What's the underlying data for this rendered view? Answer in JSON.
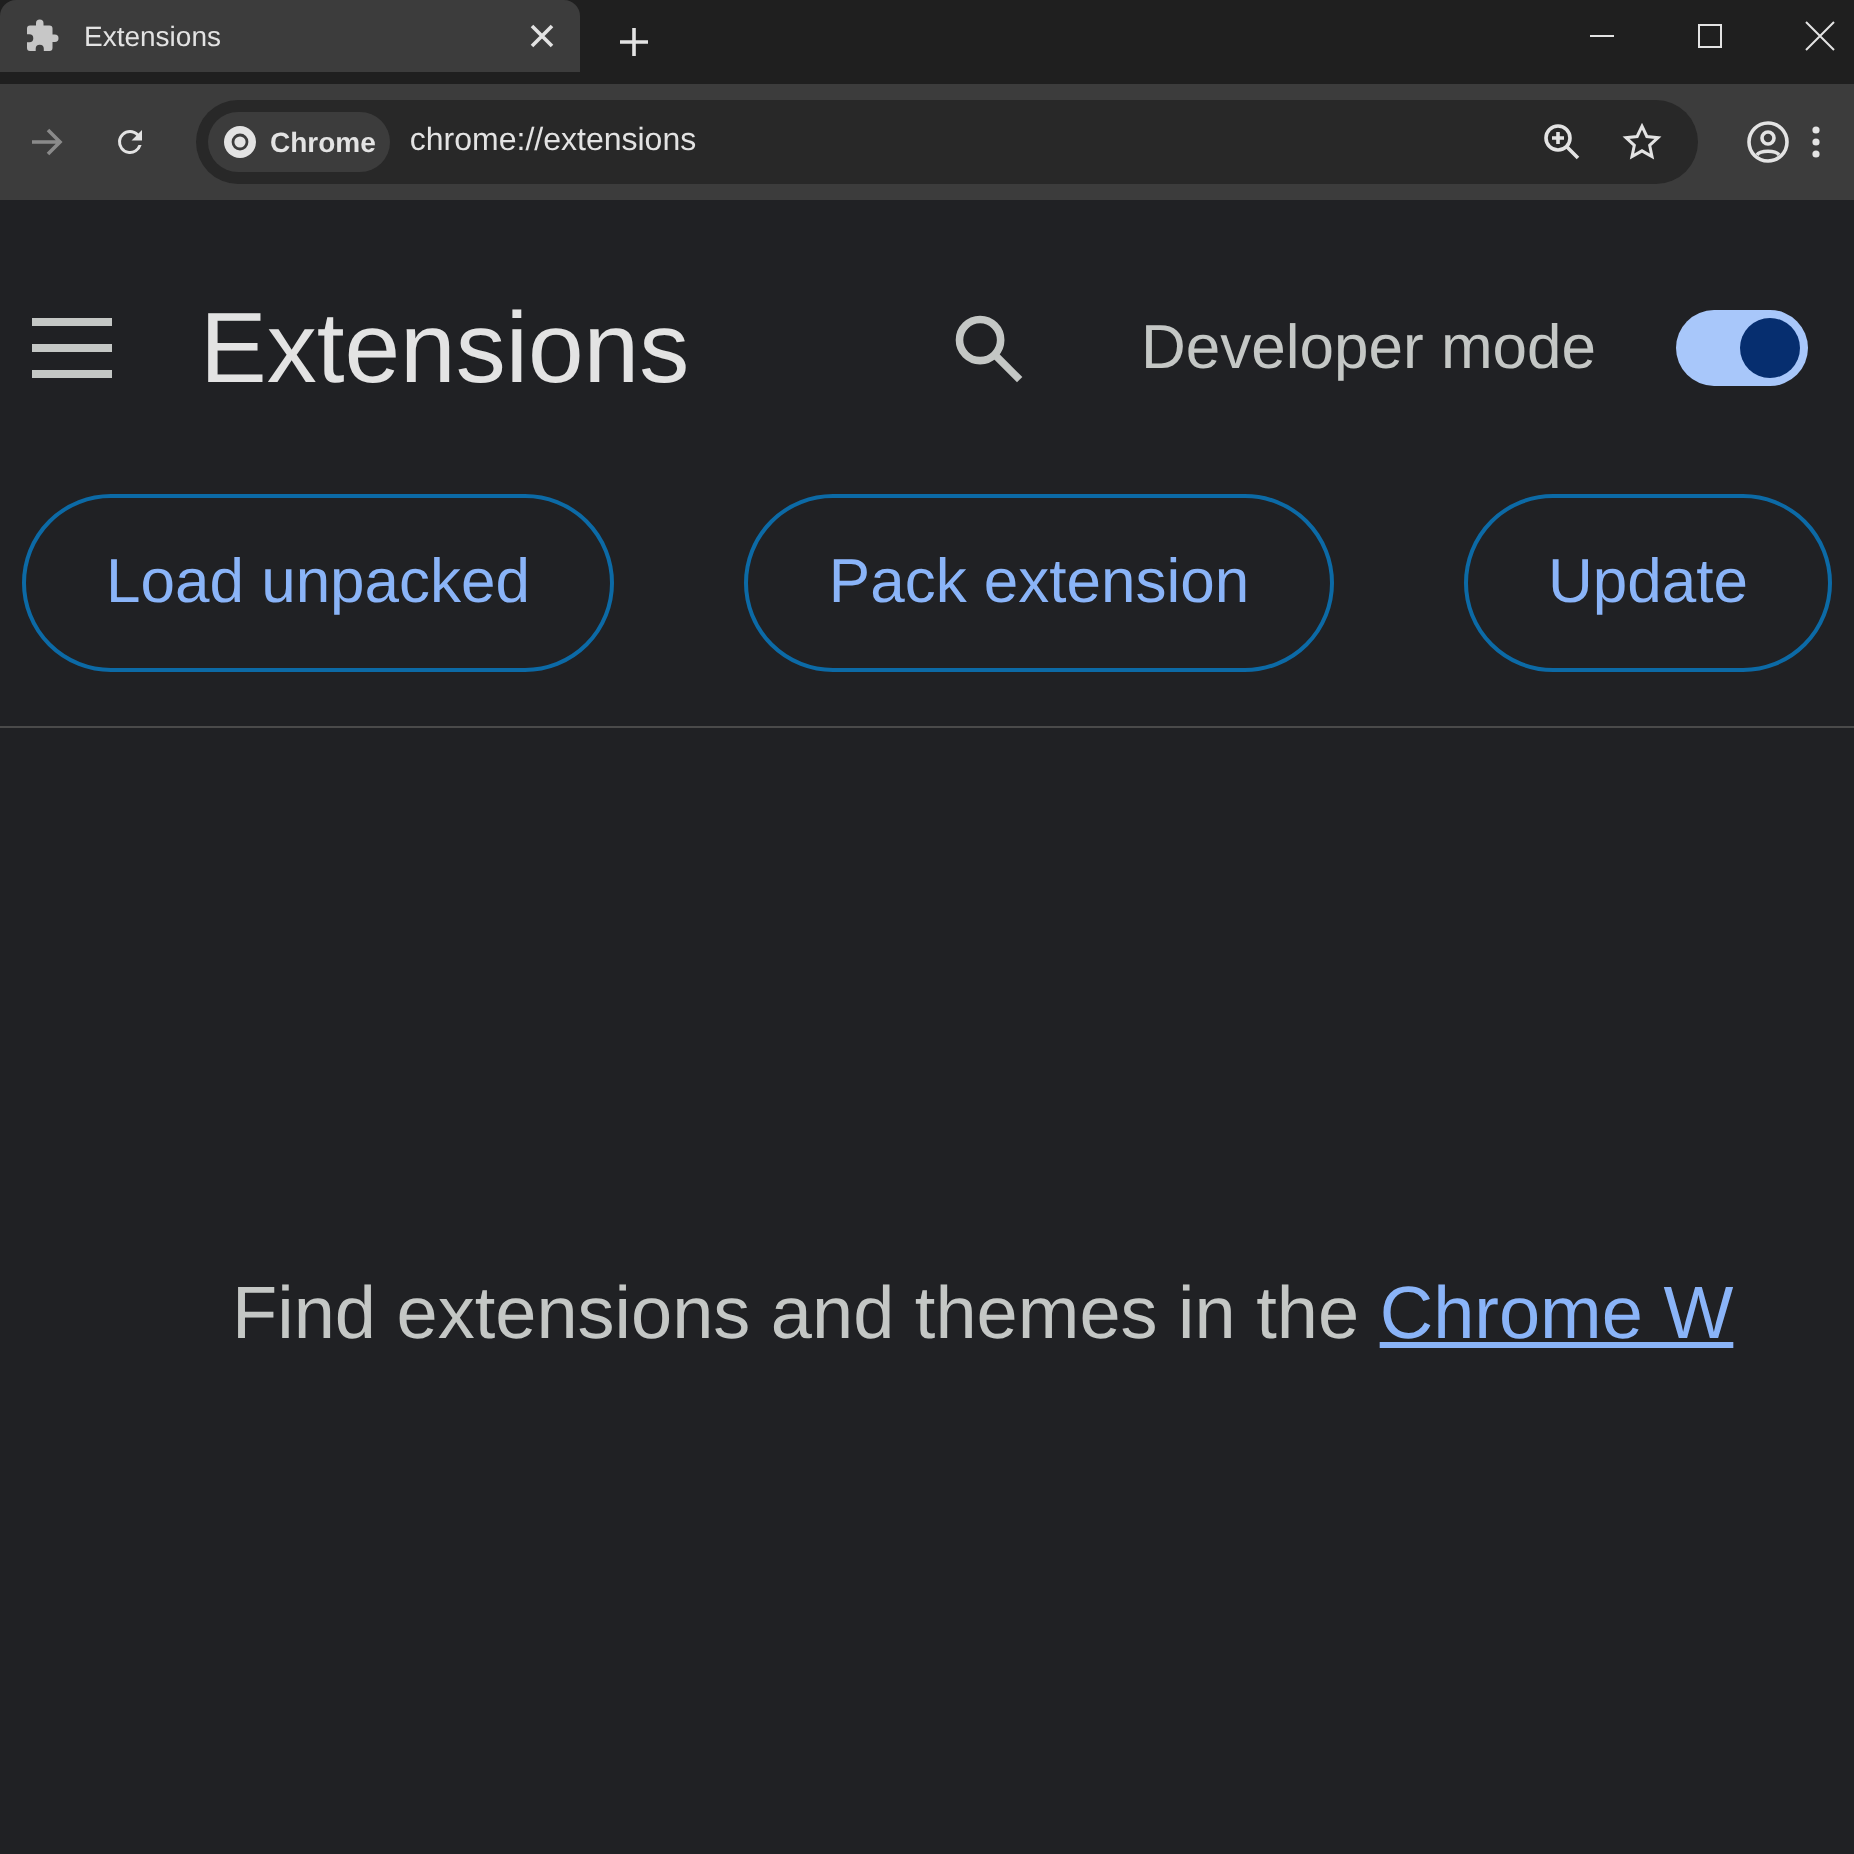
{
  "tab": {
    "title": "Extensions",
    "selected": true
  },
  "address_bar": {
    "chip": "Chrome",
    "url": "chrome://extensions"
  },
  "header": {
    "title": "Extensions",
    "developer_mode": {
      "label": "Developer mode",
      "on": true
    }
  },
  "buttons": [
    "Load unpacked",
    "Pack extension",
    "Update"
  ],
  "message": {
    "text": "Find extensions and themes in the ",
    "link": "Chrome W"
  }
}
